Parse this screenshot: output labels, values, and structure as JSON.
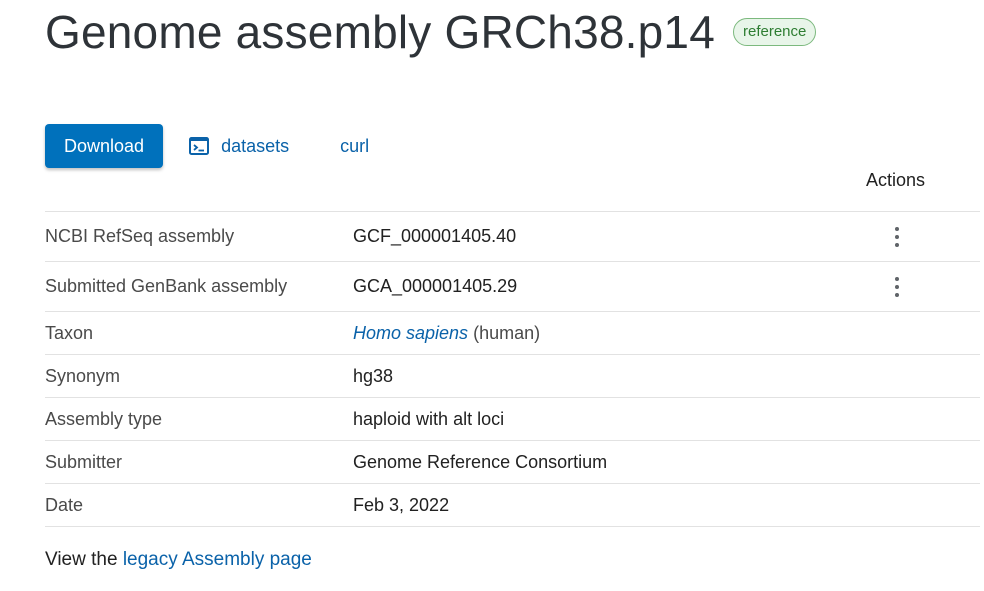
{
  "header": {
    "title": "Genome assembly GRCh38.p14",
    "badge": "reference"
  },
  "actions": {
    "download_label": "Download",
    "datasets_label": "datasets",
    "datasets_icon": "terminal-icon",
    "curl_label": "curl",
    "column_header": "Actions"
  },
  "details": {
    "refseq": {
      "label": "NCBI RefSeq assembly",
      "value": "GCF_000001405.40"
    },
    "genbank": {
      "label": "Submitted GenBank assembly",
      "value": "GCA_000001405.29"
    },
    "taxon": {
      "label": "Taxon",
      "scientific_name": "Homo sapiens",
      "common_name": "(human)"
    },
    "synonym": {
      "label": "Synonym",
      "value": "hg38"
    },
    "assembly_type": {
      "label": "Assembly type",
      "value": "haploid with alt loci"
    },
    "submitter": {
      "label": "Submitter",
      "value": "Genome Reference Consortium"
    },
    "date": {
      "label": "Date",
      "value": "Feb 3, 2022"
    }
  },
  "footer": {
    "prefix": "View the",
    "link_text": "legacy Assembly page"
  },
  "colors": {
    "primary": "#0071bc",
    "link": "#0a62a9",
    "badge_green": "#2e7d32"
  }
}
